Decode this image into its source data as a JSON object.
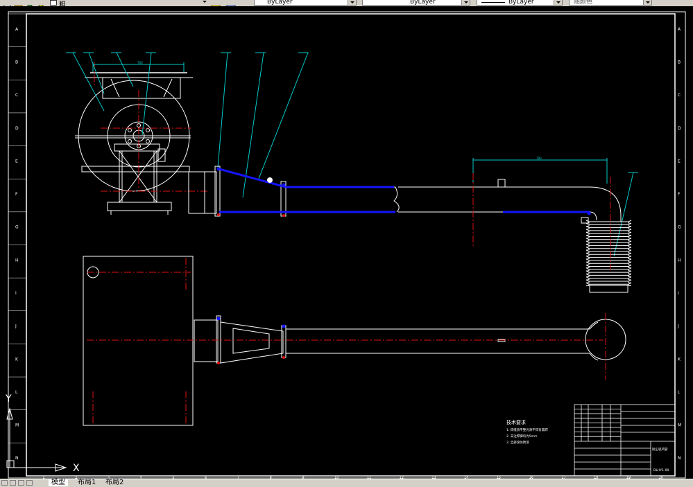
{
  "toolbar": {
    "font_name": "粗",
    "layer_combo": "ByLayer",
    "linetype_combo": "ByLayer",
    "lineweight_combo": "ByLayer",
    "color_combo": "随颜色"
  },
  "drawing": {
    "grid_letters": [
      "A",
      "B",
      "C",
      "D",
      "E",
      "F",
      "G",
      "H",
      "I",
      "J",
      "K",
      "L",
      "M",
      "N"
    ],
    "grid_numbers": [
      "1",
      "2",
      "3",
      "4",
      "5",
      "6",
      "7",
      "8",
      "9",
      "10",
      "11",
      "12",
      "13",
      "14",
      "15",
      "16",
      "17",
      "18",
      "19",
      "20"
    ],
    "dim_top": "760",
    "dim_right": "780",
    "tech_title": "技术要求",
    "tech_lines": [
      "1. 焊缝须平整光滑不得有漏焊",
      "2. 未注焊脚均为5mm",
      "3. 全部涂防锈漆"
    ],
    "title_block_name": "除尘吸风管",
    "title_block_code": "DLHY1-00"
  },
  "ucs": {
    "x_label": "X",
    "y_label": "Y"
  },
  "tabs": [
    "模型",
    "布局1",
    "布局2"
  ],
  "colors": {
    "accent_blue": "#1414ff",
    "cyan": "#00c8c8",
    "red": "#e01010",
    "white": "#ffffff"
  }
}
